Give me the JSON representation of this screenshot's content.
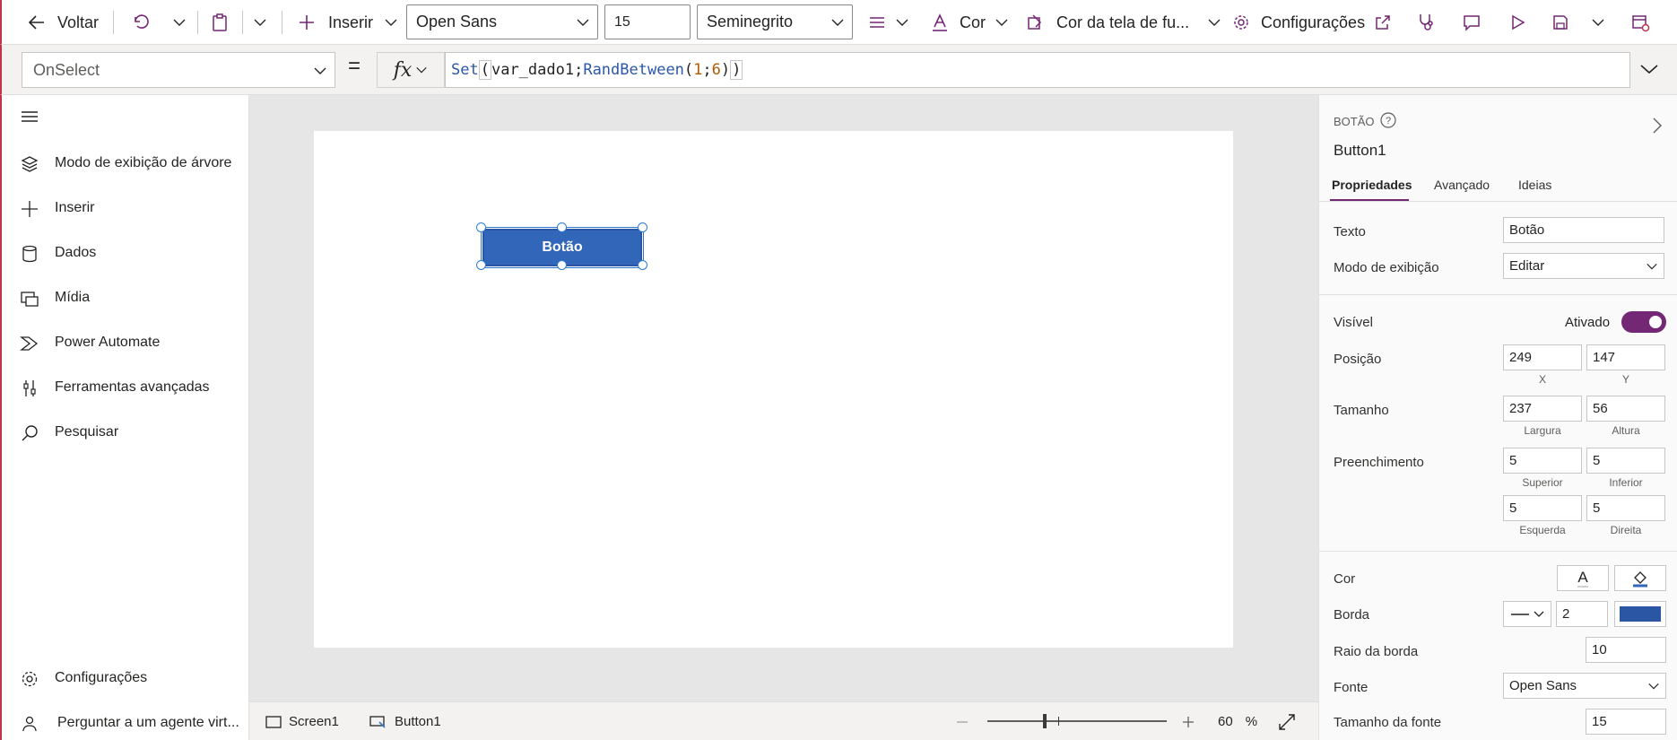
{
  "toolbar": {
    "back_label": "Voltar",
    "insert_label": "Inserir",
    "font_family_value": "Open Sans",
    "font_size_value": "15",
    "font_weight_value": "Seminegrito",
    "color_label": "Cor",
    "screen_color_label": "Cor da tela de fu...",
    "settings_label": "Configurações"
  },
  "formula_bar": {
    "property": "OnSelect",
    "equals": "=",
    "fx": "fx",
    "formula": {
      "fn1": "Set",
      "open1": "(",
      "arg1": "var_dado1;",
      "fn2": "RandBetween",
      "open2": "(",
      "n1": "1",
      "sep": ";",
      "n2": "6",
      "close2": ")",
      "close1": ")"
    }
  },
  "left_nav": {
    "items": [
      {
        "label": "Modo de exibição de árvore",
        "icon": "layers-icon"
      },
      {
        "label": "Inserir",
        "icon": "plus-icon"
      },
      {
        "label": "Dados",
        "icon": "database-icon"
      },
      {
        "label": "Mídia",
        "icon": "media-icon"
      },
      {
        "label": "Power Automate",
        "icon": "power-automate-icon"
      },
      {
        "label": "Ferramentas avançadas",
        "icon": "tools-icon"
      },
      {
        "label": "Pesquisar",
        "icon": "search-icon"
      }
    ],
    "bottom": [
      {
        "label": "Configurações",
        "icon": "gear-icon"
      },
      {
        "label": "Perguntar a um agente virt...",
        "icon": "agent-icon"
      }
    ]
  },
  "canvas": {
    "button_label": "Botão",
    "button_color": "#3266b9"
  },
  "status_bar": {
    "screen_label": "Screen1",
    "control_label": "Button1",
    "zoom_value": "60",
    "zoom_unit": "%"
  },
  "right_panel": {
    "type_label": "BOTÃO",
    "control_name": "Button1",
    "tabs": [
      "Propriedades",
      "Avançado",
      "Ideias"
    ],
    "text_label": "Texto",
    "text_value": "Botão",
    "display_mode_label": "Modo de exibição",
    "display_mode_value": "Editar",
    "visible_label": "Visível",
    "visible_state": "Ativado",
    "position_label": "Posição",
    "pos_x": "249",
    "pos_y": "147",
    "pos_x_sub": "X",
    "pos_y_sub": "Y",
    "size_label": "Tamanho",
    "width": "237",
    "height": "56",
    "width_sub": "Largura",
    "height_sub": "Altura",
    "padding_label": "Preenchimento",
    "pad_top": "5",
    "pad_bottom": "5",
    "pad_top_sub": "Superior",
    "pad_bottom_sub": "Inferior",
    "pad_left": "5",
    "pad_right": "5",
    "pad_left_sub": "Esquerda",
    "pad_right_sub": "Direita",
    "color_label": "Cor",
    "color_text_glyph": "A",
    "border_label": "Borda",
    "border_width": "2",
    "border_color": "#2a56a3",
    "radius_label": "Raio da borda",
    "radius_value": "10",
    "font_label": "Fonte",
    "font_value": "Open Sans",
    "font_size_label": "Tamanho da fonte",
    "font_size_value": "15",
    "toggle_color": "#742774"
  }
}
